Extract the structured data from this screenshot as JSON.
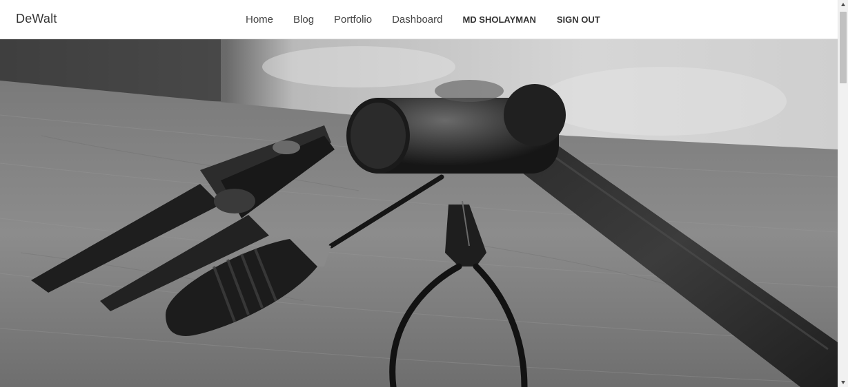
{
  "navbar": {
    "brand": "DeWalt",
    "links": [
      {
        "label": "Home"
      },
      {
        "label": "Blog"
      },
      {
        "label": "Portfolio"
      },
      {
        "label": "Dashboard"
      },
      {
        "label": "MD SHOLAYMAN"
      },
      {
        "label": "SIGN OUT"
      }
    ]
  },
  "hero": {
    "image": "tools-on-workbench-photo",
    "style": "grayscale"
  },
  "colors": {
    "navbar_bg": "#ffffff",
    "brand_text": "#333333",
    "link_text": "#444444"
  }
}
